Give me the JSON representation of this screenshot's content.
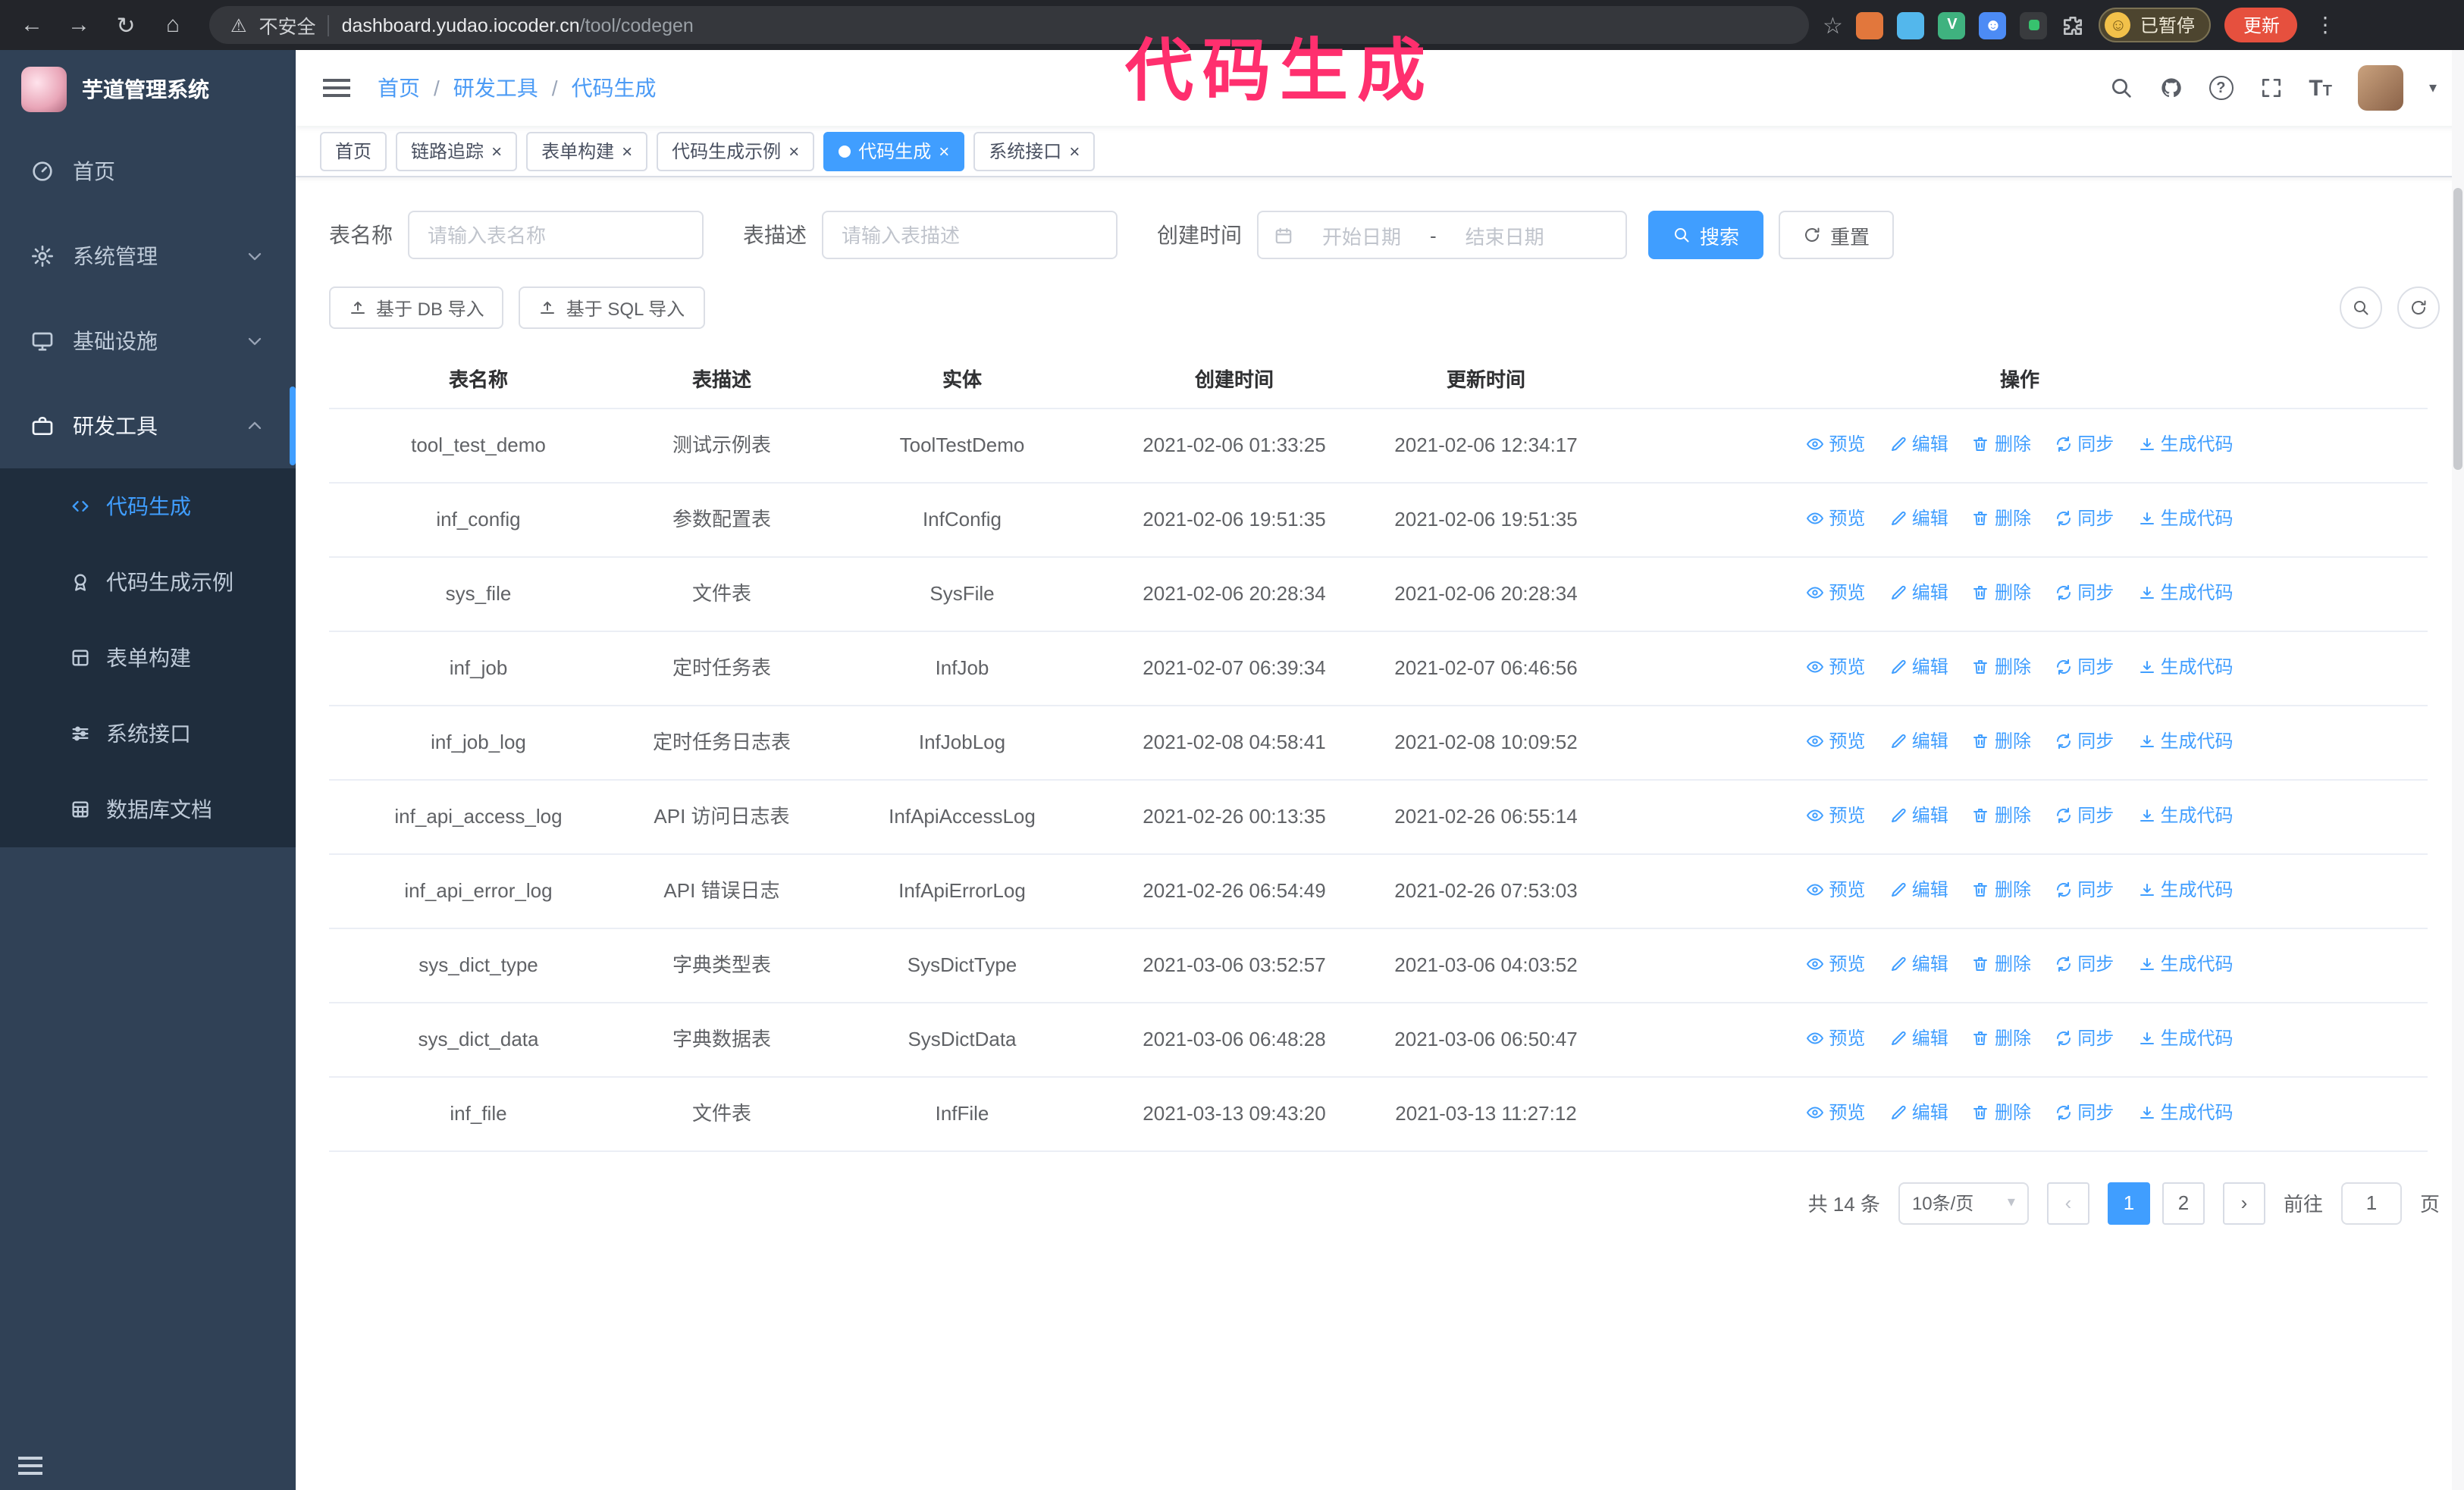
{
  "colors": {
    "accent": "#409eff",
    "annotation_pink": "#ff2f6e",
    "sidebar_bg": "#304156",
    "submenu_bg": "#1f2d3d",
    "chrome_bg": "#23252a",
    "update_button_bg": "#e6503e"
  },
  "glyphs": {
    "back": "←",
    "forward": "→",
    "reload": "↻",
    "home": "⌂",
    "warning": "⚠",
    "star": "☆",
    "dots": "⋮",
    "smiley": "☺",
    "vue": "V",
    "person": "☻",
    "caret_down": "▾",
    "question": "?",
    "font_large": "T",
    "font_small": "T",
    "prev": "‹",
    "next": "›",
    "close": "×",
    "crumb_sep": "/"
  },
  "annotation": "代码生成",
  "browser": {
    "security_label": "不安全",
    "url_host": "dashboard.yudao.iocoder.cn",
    "url_path": "/tool/codegen",
    "paused_badge": "已暂停",
    "update_button": "更新"
  },
  "sidebar": {
    "logo_title": "芋道管理系统",
    "items": [
      {
        "label": "首页"
      },
      {
        "label": "系统管理"
      },
      {
        "label": "基础设施"
      },
      {
        "label": "研发工具"
      }
    ],
    "submenu": [
      {
        "label": "代码生成",
        "active": true
      },
      {
        "label": "代码生成示例"
      },
      {
        "label": "表单构建"
      },
      {
        "label": "系统接口"
      },
      {
        "label": "数据库文档"
      }
    ]
  },
  "header": {
    "breadcrumb": [
      "首页",
      "研发工具",
      "代码生成"
    ]
  },
  "tabs": [
    {
      "label": "首页",
      "closable": false,
      "active": false
    },
    {
      "label": "链路追踪",
      "closable": true,
      "active": false
    },
    {
      "label": "表单构建",
      "closable": true,
      "active": false
    },
    {
      "label": "代码生成示例",
      "closable": true,
      "active": false
    },
    {
      "label": "代码生成",
      "closable": true,
      "active": true
    },
    {
      "label": "系统接口",
      "closable": true,
      "active": false
    }
  ],
  "filters": {
    "table_name_label": "表名称",
    "table_name_placeholder": "请输入表名称",
    "table_desc_label": "表描述",
    "table_desc_placeholder": "请输入表描述",
    "create_time_label": "创建时间",
    "date_start_placeholder": "开始日期",
    "date_separator": "-",
    "date_end_placeholder": "结束日期",
    "search_button": "搜索",
    "reset_button": "重置"
  },
  "toolbar": {
    "import_db_button": "基于 DB 导入",
    "import_sql_button": "基于 SQL 导入"
  },
  "table": {
    "columns": [
      "表名称",
      "表描述",
      "实体",
      "创建时间",
      "更新时间",
      "操作"
    ],
    "actions": [
      "预览",
      "编辑",
      "删除",
      "同步",
      "生成代码"
    ],
    "rows": [
      {
        "name": "tool_test_demo",
        "desc": "测试示例表",
        "entity": "ToolTestDemo",
        "created": "2021-02-06 01:33:25",
        "updated": "2021-02-06 12:34:17"
      },
      {
        "name": "inf_config",
        "desc": "参数配置表",
        "entity": "InfConfig",
        "created": "2021-02-06 19:51:35",
        "updated": "2021-02-06 19:51:35"
      },
      {
        "name": "sys_file",
        "desc": "文件表",
        "entity": "SysFile",
        "created": "2021-02-06 20:28:34",
        "updated": "2021-02-06 20:28:34"
      },
      {
        "name": "inf_job",
        "desc": "定时任务表",
        "entity": "InfJob",
        "created": "2021-02-07 06:39:34",
        "updated": "2021-02-07 06:46:56"
      },
      {
        "name": "inf_job_log",
        "desc": "定时任务日志表",
        "entity": "InfJobLog",
        "created": "2021-02-08 04:58:41",
        "updated": "2021-02-08 10:09:52"
      },
      {
        "name": "inf_api_access_log",
        "desc": "API 访问日志表",
        "entity": "InfApiAccessLog",
        "created": "2021-02-26 00:13:35",
        "updated": "2021-02-26 06:55:14"
      },
      {
        "name": "inf_api_error_log",
        "desc": "API 错误日志",
        "entity": "InfApiErrorLog",
        "created": "2021-02-26 06:54:49",
        "updated": "2021-02-26 07:53:03"
      },
      {
        "name": "sys_dict_type",
        "desc": "字典类型表",
        "entity": "SysDictType",
        "created": "2021-03-06 03:52:57",
        "updated": "2021-03-06 04:03:52"
      },
      {
        "name": "sys_dict_data",
        "desc": "字典数据表",
        "entity": "SysDictData",
        "created": "2021-03-06 06:48:28",
        "updated": "2021-03-06 06:50:47"
      },
      {
        "name": "inf_file",
        "desc": "文件表",
        "entity": "InfFile",
        "created": "2021-03-13 09:43:20",
        "updated": "2021-03-13 11:27:12"
      }
    ]
  },
  "pagination": {
    "total_text": "共 14 条",
    "page_size": "10条/页",
    "pages": [
      {
        "label": "1",
        "active": true
      },
      {
        "label": "2",
        "active": false
      }
    ],
    "goto_label": "前往",
    "goto_value": "1",
    "goto_suffix": "页"
  }
}
